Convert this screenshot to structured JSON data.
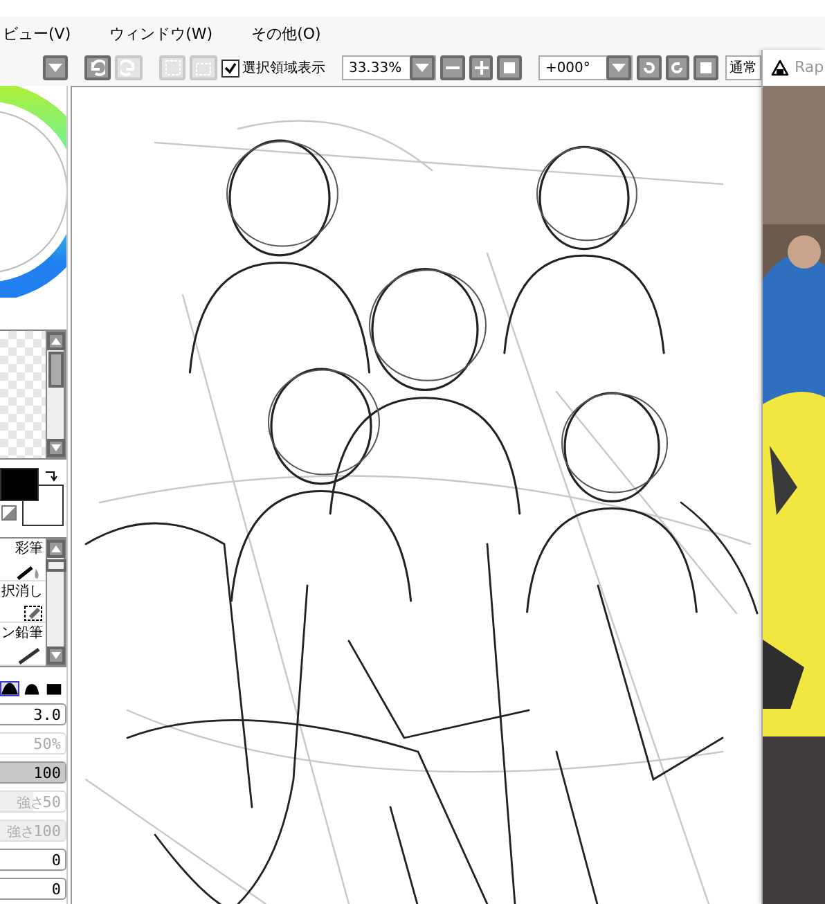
{
  "menu": [
    {
      "label": "ビュー(V)"
    },
    {
      "label": "ウィンドウ(W)"
    },
    {
      "label": "その他(O)"
    }
  ],
  "toolbar": {
    "history": [
      {
        "kind": "undo",
        "disabled": false
      },
      {
        "kind": "redo",
        "disabled": true
      },
      {
        "kind": "select",
        "disabled": true
      },
      {
        "kind": "deselect",
        "disabled": true
      }
    ],
    "selection_display": {
      "label": "選択領域表示",
      "checked": true
    },
    "zoom": "33.33%",
    "rotation": "+000°",
    "blend_mode": "通常"
  },
  "tools": [
    {
      "label": "彩筆",
      "kind": "brush"
    },
    {
      "label": "択消し",
      "kind": "eraser"
    },
    {
      "label": "ン鉛筆",
      "kind": "pencil"
    }
  ],
  "tip_shapes": [
    {
      "selected": true
    },
    {
      "selected": false
    },
    {
      "selected": false
    }
  ],
  "settings": [
    {
      "kind": "field",
      "value": "3.0",
      "disabled": false
    },
    {
      "kind": "field",
      "value": "50%",
      "disabled": true
    },
    {
      "kind": "slider",
      "value": "100",
      "level": 1,
      "disabled": false
    },
    {
      "kind": "slider",
      "label": "強さ",
      "value": "50",
      "level": 0.5,
      "disabled": true
    },
    {
      "kind": "slider",
      "label": "強さ",
      "value": "100",
      "level": 1,
      "disabled": true
    },
    {
      "kind": "field",
      "value": "0",
      "disabled": false
    },
    {
      "kind": "field",
      "value": "0",
      "disabled": false
    }
  ],
  "side_window": {
    "title": "Rap"
  }
}
